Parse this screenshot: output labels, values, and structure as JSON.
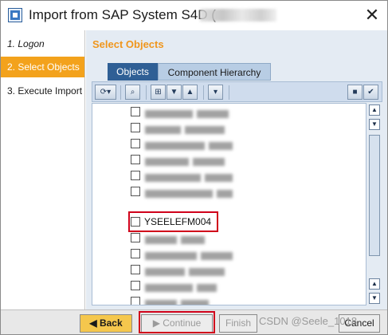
{
  "window": {
    "title": "Import from SAP System S4D ("
  },
  "nav": {
    "items": [
      {
        "label": "1. Logon"
      },
      {
        "label": "2. Select Objects"
      },
      {
        "label": "3. Execute Import"
      }
    ]
  },
  "main": {
    "section_title": "Select Objects",
    "tabs": [
      {
        "label": "Objects"
      },
      {
        "label": "Component Hierarchy"
      }
    ]
  },
  "tree": {
    "visible_item": "YSEELEFM004"
  },
  "footer": {
    "back_label": "Back",
    "continue_label": "Continue",
    "finish_label": "Finish",
    "cancel_label": "Cancel",
    "watermark": "CSDN @Seele_1018"
  }
}
